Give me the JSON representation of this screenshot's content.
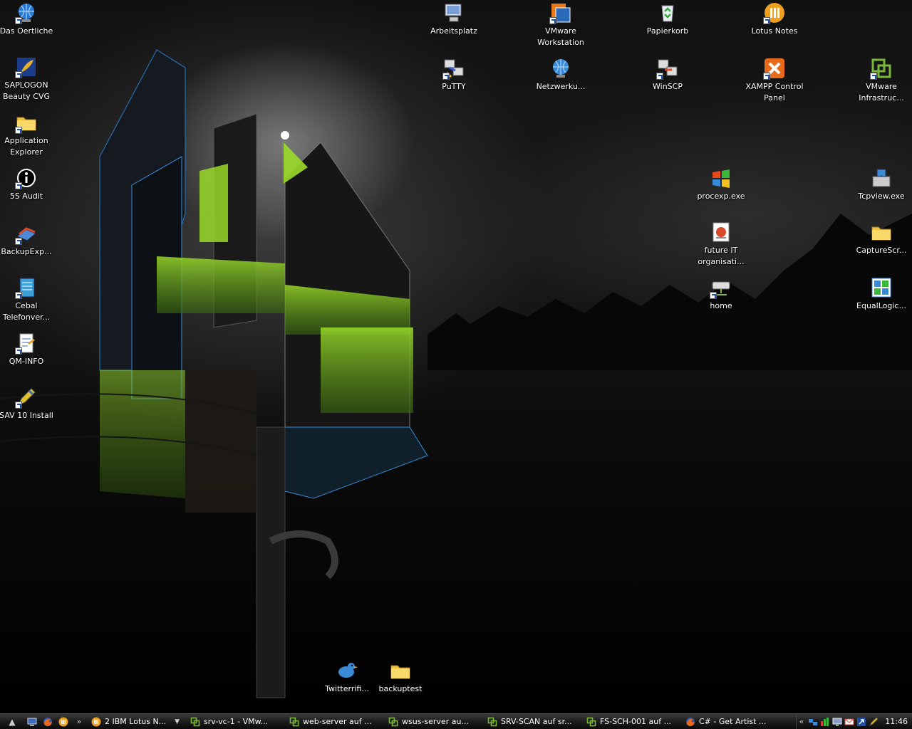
{
  "desktop_icons": [
    {
      "name": "das-oertliche",
      "label": "Das Oertliche",
      "icon": "phone-globe-icon",
      "color": "#2a7ad8"
    },
    {
      "name": "saplogon",
      "label": "SAPLOGON Beauty CVG",
      "icon": "sap-logon-icon",
      "color": "#e8b020"
    },
    {
      "name": "application-explorer",
      "label": "Application Explorer",
      "icon": "folder-icon",
      "color": "#f0c040"
    },
    {
      "name": "5s-audit",
      "label": "5S Audit",
      "icon": "info-icon",
      "color": "#ffffff"
    },
    {
      "name": "backupexp",
      "label": "BackupExp...",
      "icon": "backup-icon",
      "color": "#d84a2a"
    },
    {
      "name": "cebal",
      "label": "Cebal Telefonver...",
      "icon": "notebook-icon",
      "color": "#3aa0d8"
    },
    {
      "name": "qm-info",
      "label": "QM-INFO",
      "icon": "document-icon",
      "color": "#ffffff"
    },
    {
      "name": "sav-10-install",
      "label": "SAV 10 Install",
      "icon": "pen-icon",
      "color": "#e0c030"
    },
    {
      "name": "arbeitsplatz",
      "label": "Arbeitsplatz",
      "icon": "computer-icon",
      "color": "#7aa0d8"
    },
    {
      "name": "vmware-workstation",
      "label": "VMware Workstation",
      "icon": "vmware-icon",
      "color": "#2a6ab8"
    },
    {
      "name": "papierkorb",
      "label": "Papierkorb",
      "icon": "recycle-bin-icon",
      "color": "#3aa83a"
    },
    {
      "name": "lotus-notes",
      "label": "Lotus Notes",
      "icon": "lotus-notes-icon",
      "color": "#f0a020"
    },
    {
      "name": "putty",
      "label": "PuTTY",
      "icon": "putty-icon",
      "color": "#3a5ad8"
    },
    {
      "name": "netzwerk",
      "label": "Netzwerku...",
      "icon": "network-globe-icon",
      "color": "#3a8ad8"
    },
    {
      "name": "winscp",
      "label": "WinSCP",
      "icon": "winscp-icon",
      "color": "#d84a2a"
    },
    {
      "name": "xampp",
      "label": "XAMPP Control Panel",
      "icon": "xampp-icon",
      "color": "#e86a1a"
    },
    {
      "name": "vmware-infrastructure",
      "label": "VMware Infrastruc...",
      "icon": "vmware-infra-icon",
      "color": "#7ab83a"
    },
    {
      "name": "procexp",
      "label": "procexp.exe",
      "icon": "windows-flag-icon",
      "color": "#3a8ad8"
    },
    {
      "name": "tcpview",
      "label": "Tcpview.exe",
      "icon": "tcpview-icon",
      "color": "#3a8ad8"
    },
    {
      "name": "future-it",
      "label": "future IT organisati...",
      "icon": "powerpoint-icon",
      "color": "#d84a2a"
    },
    {
      "name": "capturescr",
      "label": "CaptureScr...",
      "icon": "folder-icon",
      "color": "#f0c040"
    },
    {
      "name": "home",
      "label": "home",
      "icon": "network-drive-icon",
      "color": "#cccccc"
    },
    {
      "name": "equallogic",
      "label": "EqualLogic...",
      "icon": "equallogic-icon",
      "color": "#3a8ad8"
    },
    {
      "name": "twitterrific",
      "label": "Twitterrifi...",
      "icon": "twitter-bird-icon",
      "color": "#3a8ad8"
    },
    {
      "name": "backuptest",
      "label": "backuptest",
      "icon": "folder-icon",
      "color": "#f0c040"
    }
  ],
  "taskbar": {
    "quick_launch": [
      {
        "name": "show-desktop",
        "icon": "desktop-icon",
        "color": "#3a6ab8"
      },
      {
        "name": "firefox",
        "icon": "firefox-icon",
        "color": "#e86a1a"
      },
      {
        "name": "lotus-notes",
        "icon": "lotus-notes-icon",
        "color": "#f0a020"
      }
    ],
    "chevron": "»",
    "tasks": [
      {
        "name": "lotus-notes-group",
        "label": "2 IBM Lotus N...",
        "icon": "lotus-notes-icon",
        "color": "#f0a020",
        "group": true
      },
      {
        "name": "srv-vc-1",
        "label": "srv-vc-1 - VMw...",
        "icon": "vmware-infra-icon",
        "color": "#7ab83a"
      },
      {
        "name": "web-server",
        "label": "web-server auf ...",
        "icon": "vmware-infra-icon",
        "color": "#7ab83a"
      },
      {
        "name": "wsus-server",
        "label": "wsus-server au...",
        "icon": "vmware-infra-icon",
        "color": "#7ab83a"
      },
      {
        "name": "srv-scan",
        "label": "SRV-SCAN auf sr...",
        "icon": "vmware-infra-icon",
        "color": "#7ab83a"
      },
      {
        "name": "fs-sch-001",
        "label": "FS-SCH-001 auf ...",
        "icon": "vmware-infra-icon",
        "color": "#7ab83a"
      },
      {
        "name": "firefox-getartist",
        "label": "C# - Get Artist ...",
        "icon": "firefox-icon",
        "color": "#e86a1a"
      }
    ],
    "tray_chevron": "«",
    "tray_icons": [
      {
        "name": "network-tray",
        "icon": "network-tray-icon",
        "color": "#3a8ad8"
      },
      {
        "name": "bars-tray",
        "icon": "bars-tray-icon",
        "color": "#3ab83a"
      },
      {
        "name": "monitor-tray",
        "icon": "monitor-tray-icon",
        "color": "#8aa0c8"
      },
      {
        "name": "mail-tray",
        "icon": "mail-tray-icon",
        "color": "#d83a3a"
      },
      {
        "name": "arrow-tray",
        "icon": "arrow-tray-icon",
        "color": "#ffffff"
      },
      {
        "name": "pen-tray",
        "icon": "pen-tray-icon",
        "color": "#e0c030"
      }
    ],
    "clock": "11:46"
  }
}
